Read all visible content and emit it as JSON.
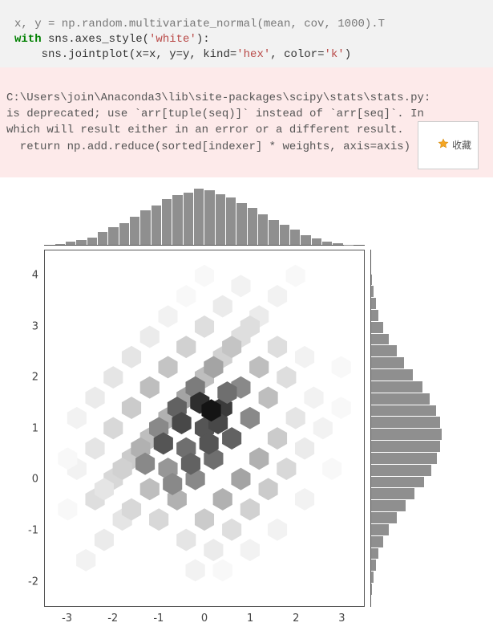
{
  "code": {
    "line0": "x, y = np.random.multivariate_normal(mean, cov, 1000).T",
    "with_kw": "with",
    "with_rest_a": " sns.axes_style(",
    "with_str1": "'white'",
    "with_rest_b": "):",
    "call_indent": "    sns.jointplot(x=x, y=y, kind=",
    "call_str_kind": "'hex'",
    "call_mid": ", color=",
    "call_str_color": "'k'",
    "call_end": ")"
  },
  "warning": {
    "line1": "C:\\Users\\join\\Anaconda3\\lib\\site-packages\\scipy\\stats\\stats.py:",
    "line2": "is deprecated; use `arr[tuple(seq)]` instead of `arr[seq]`. In ",
    "line3": "which will result either in an error or a different result.",
    "line4": "  return np.add.reduce(sorted[indexer] * weights, axis=axis) /"
  },
  "favorite": {
    "label": "收藏"
  },
  "chart_data": {
    "type": "hexbin-joint",
    "xlim": [
      -3.5,
      3.5
    ],
    "ylim": [
      -2.5,
      4.5
    ],
    "x_ticks": [
      -3,
      -2,
      -1,
      0,
      1,
      2,
      3
    ],
    "y_ticks": [
      -2,
      -1,
      0,
      1,
      2,
      3,
      4
    ],
    "color": "k",
    "marginals": {
      "x_bins": 30,
      "x_counts": [
        0,
        2,
        5,
        8,
        12,
        20,
        28,
        35,
        44,
        55,
        62,
        72,
        78,
        82,
        88,
        86,
        80,
        74,
        66,
        58,
        48,
        40,
        32,
        24,
        16,
        10,
        6,
        3,
        1,
        0
      ],
      "y_bins": 30,
      "y_counts": [
        0,
        1,
        3,
        6,
        10,
        16,
        24,
        34,
        46,
        58,
        70,
        80,
        88,
        92,
        94,
        92,
        86,
        78,
        68,
        56,
        44,
        34,
        24,
        16,
        10,
        6,
        3,
        1,
        0,
        0
      ]
    },
    "hexes": [
      {
        "x": -2.6,
        "y": -1.6,
        "c": 2
      },
      {
        "x": -2.2,
        "y": -1.2,
        "c": 3
      },
      {
        "x": -1.8,
        "y": -0.8,
        "c": 4
      },
      {
        "x": -2.4,
        "y": -0.4,
        "c": 5
      },
      {
        "x": -2.0,
        "y": 0.0,
        "c": 6
      },
      {
        "x": -1.6,
        "y": 0.4,
        "c": 8
      },
      {
        "x": -1.2,
        "y": 0.8,
        "c": 10
      },
      {
        "x": -0.8,
        "y": 1.2,
        "c": 12
      },
      {
        "x": -0.4,
        "y": 1.6,
        "c": 14
      },
      {
        "x": 0.0,
        "y": 2.0,
        "c": 10
      },
      {
        "x": 0.4,
        "y": 2.4,
        "c": 7
      },
      {
        "x": 0.8,
        "y": 2.8,
        "c": 5
      },
      {
        "x": 1.2,
        "y": 3.2,
        "c": 3
      },
      {
        "x": 1.6,
        "y": 3.6,
        "c": 2
      },
      {
        "x": 2.0,
        "y": 4.0,
        "c": 1
      },
      {
        "x": -2.8,
        "y": 0.2,
        "c": 2
      },
      {
        "x": -2.4,
        "y": 0.6,
        "c": 4
      },
      {
        "x": -2.0,
        "y": 1.0,
        "c": 6
      },
      {
        "x": -1.6,
        "y": 1.4,
        "c": 8
      },
      {
        "x": -1.2,
        "y": 1.8,
        "c": 10
      },
      {
        "x": -0.8,
        "y": 2.2,
        "c": 9
      },
      {
        "x": -0.4,
        "y": 2.6,
        "c": 7
      },
      {
        "x": 0.0,
        "y": 3.0,
        "c": 5
      },
      {
        "x": 0.4,
        "y": 3.4,
        "c": 3
      },
      {
        "x": 0.8,
        "y": 3.8,
        "c": 2
      },
      {
        "x": -2.2,
        "y": -0.2,
        "c": 4
      },
      {
        "x": -1.8,
        "y": 0.2,
        "c": 7
      },
      {
        "x": -1.4,
        "y": 0.6,
        "c": 12
      },
      {
        "x": -1.0,
        "y": 1.0,
        "c": 18
      },
      {
        "x": -0.6,
        "y": 1.4,
        "c": 24
      },
      {
        "x": -0.2,
        "y": 1.8,
        "c": 20
      },
      {
        "x": 0.2,
        "y": 2.2,
        "c": 14
      },
      {
        "x": 0.6,
        "y": 2.6,
        "c": 9
      },
      {
        "x": 1.0,
        "y": 3.0,
        "c": 5
      },
      {
        "x": -1.6,
        "y": -0.6,
        "c": 6
      },
      {
        "x": -1.2,
        "y": -0.2,
        "c": 10
      },
      {
        "x": -0.8,
        "y": 0.2,
        "c": 16
      },
      {
        "x": -0.4,
        "y": 0.6,
        "c": 22
      },
      {
        "x": 0.0,
        "y": 1.0,
        "c": 26
      },
      {
        "x": 0.4,
        "y": 1.4,
        "c": 30
      },
      {
        "x": 0.8,
        "y": 1.8,
        "c": 18
      },
      {
        "x": 1.2,
        "y": 2.2,
        "c": 10
      },
      {
        "x": 1.6,
        "y": 2.6,
        "c": 5
      },
      {
        "x": -1.0,
        "y": -0.8,
        "c": 6
      },
      {
        "x": -0.6,
        "y": -0.4,
        "c": 12
      },
      {
        "x": -0.2,
        "y": 0.0,
        "c": 18
      },
      {
        "x": 0.2,
        "y": 0.4,
        "c": 22
      },
      {
        "x": 0.6,
        "y": 0.8,
        "c": 24
      },
      {
        "x": 1.0,
        "y": 1.2,
        "c": 18
      },
      {
        "x": 1.4,
        "y": 1.6,
        "c": 10
      },
      {
        "x": 1.8,
        "y": 2.0,
        "c": 5
      },
      {
        "x": 2.2,
        "y": 2.4,
        "c": 2
      },
      {
        "x": -0.4,
        "y": -1.2,
        "c": 4
      },
      {
        "x": 0.0,
        "y": -0.8,
        "c": 8
      },
      {
        "x": 0.4,
        "y": -0.4,
        "c": 12
      },
      {
        "x": 0.8,
        "y": 0.0,
        "c": 14
      },
      {
        "x": 1.2,
        "y": 0.4,
        "c": 12
      },
      {
        "x": 1.6,
        "y": 0.8,
        "c": 8
      },
      {
        "x": 2.0,
        "y": 1.2,
        "c": 4
      },
      {
        "x": 2.4,
        "y": 1.6,
        "c": 2
      },
      {
        "x": 0.2,
        "y": -1.4,
        "c": 3
      },
      {
        "x": 0.6,
        "y": -1.0,
        "c": 5
      },
      {
        "x": 1.0,
        "y": -0.6,
        "c": 7
      },
      {
        "x": 1.4,
        "y": -0.2,
        "c": 8
      },
      {
        "x": 1.8,
        "y": 0.2,
        "c": 6
      },
      {
        "x": 2.2,
        "y": 0.6,
        "c": 3
      },
      {
        "x": 2.6,
        "y": 1.0,
        "c": 2
      },
      {
        "x": 3.0,
        "y": 1.4,
        "c": 1
      },
      {
        "x": -0.9,
        "y": 0.7,
        "c": 26
      },
      {
        "x": -0.5,
        "y": 1.1,
        "c": 28
      },
      {
        "x": -0.1,
        "y": 1.5,
        "c": 32
      },
      {
        "x": 0.3,
        "y": 1.1,
        "c": 28
      },
      {
        "x": -0.3,
        "y": 0.3,
        "c": 24
      },
      {
        "x": 0.1,
        "y": 0.7,
        "c": 26
      },
      {
        "x": -1.3,
        "y": 0.3,
        "c": 18
      },
      {
        "x": -0.7,
        "y": -0.1,
        "c": 18
      },
      {
        "x": 0.5,
        "y": 1.7,
        "c": 22
      },
      {
        "x": 0.15,
        "y": 1.35,
        "c": 36
      },
      {
        "x": -2.8,
        "y": 1.2,
        "c": 2
      },
      {
        "x": -2.4,
        "y": 1.6,
        "c": 3
      },
      {
        "x": -2.0,
        "y": 2.0,
        "c": 4
      },
      {
        "x": -1.6,
        "y": 2.4,
        "c": 4
      },
      {
        "x": -1.2,
        "y": 2.8,
        "c": 3
      },
      {
        "x": -0.8,
        "y": 3.2,
        "c": 2
      },
      {
        "x": -0.4,
        "y": 3.6,
        "c": 1
      },
      {
        "x": 0.0,
        "y": 4.0,
        "c": 1
      },
      {
        "x": -0.2,
        "y": -1.8,
        "c": 2
      },
      {
        "x": 0.4,
        "y": -1.8,
        "c": 1
      },
      {
        "x": 1.0,
        "y": -1.4,
        "c": 2
      },
      {
        "x": 1.6,
        "y": -1.0,
        "c": 2
      },
      {
        "x": 2.2,
        "y": -0.4,
        "c": 2
      },
      {
        "x": 2.8,
        "y": 0.2,
        "c": 1
      },
      {
        "x": -3.0,
        "y": -0.6,
        "c": 1
      },
      {
        "x": -3.0,
        "y": 0.4,
        "c": 1
      },
      {
        "x": 3.0,
        "y": 2.2,
        "c": 1
      }
    ]
  }
}
